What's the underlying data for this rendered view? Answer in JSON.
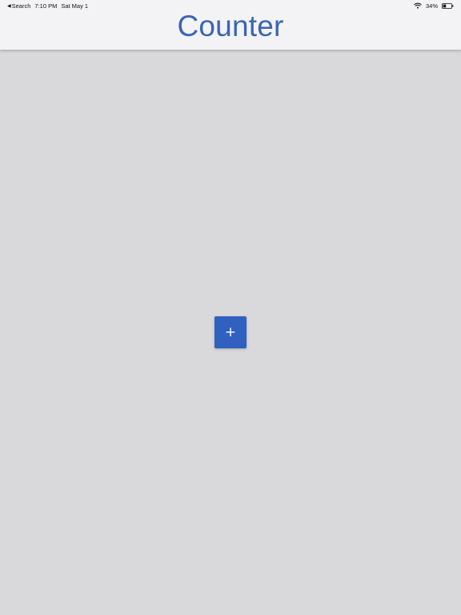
{
  "status_bar": {
    "back_label": "Search",
    "time": "7:10 PM",
    "date": "Sat May 1",
    "battery": "34%"
  },
  "header": {
    "title": "Counter"
  },
  "main": {
    "add_button": {
      "symbol": "+"
    }
  },
  "colors": {
    "accent": "#3a64b4",
    "button": "#3060c0",
    "header_bg": "#f3f2f5",
    "content_bg": "#d9d8db"
  },
  "icons": [
    "back-arrow-icon",
    "wifi-icon",
    "battery-icon",
    "plus-icon"
  ]
}
